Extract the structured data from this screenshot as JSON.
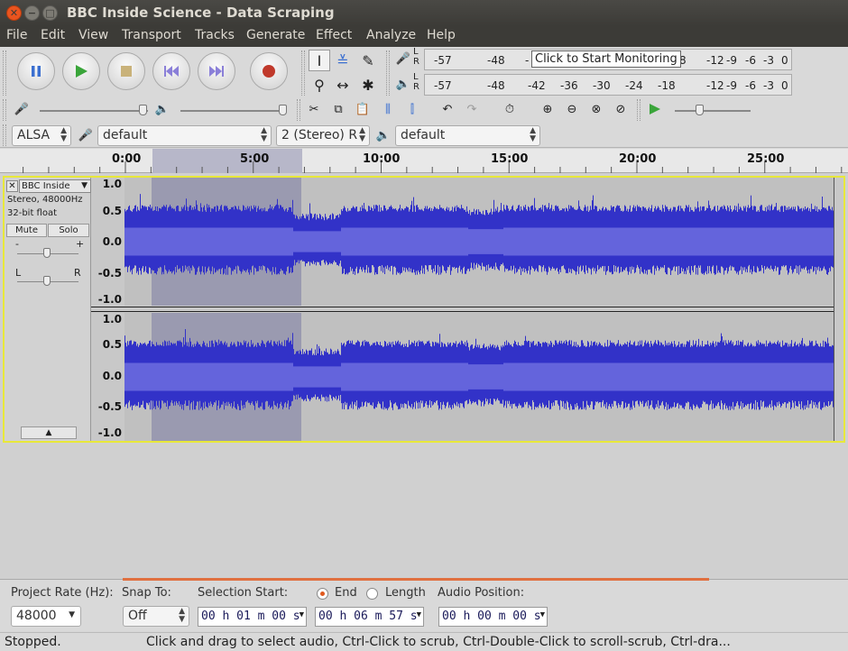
{
  "window": {
    "title": "BBC Inside Science - Data Scraping"
  },
  "menu": [
    "File",
    "Edit",
    "View",
    "Transport",
    "Tracks",
    "Generate",
    "Effect",
    "Analyze",
    "Help"
  ],
  "meters": {
    "record_scale": [
      "-57",
      "-48",
      "-",
      "8",
      "-12",
      "-9",
      "-6",
      "-3",
      "0"
    ],
    "play_scale": [
      "-57",
      "-48",
      "-42",
      "-36",
      "-30",
      "-24",
      "-18",
      "-12",
      "-9",
      "-6",
      "-3",
      "0"
    ],
    "tooltip": "Click to Start Monitoring",
    "lr_top": "L R",
    "lr_bottom": "L R"
  },
  "device": {
    "host": "ALSA",
    "recording_device": "default",
    "channels": "2 (Stereo) R",
    "playback_device": "default"
  },
  "ruler": {
    "labels": [
      "0:00",
      "5:00",
      "10:00",
      "15:00",
      "20:00",
      "25:00"
    ]
  },
  "track": {
    "name": "BBC Inside",
    "format": "Stereo, 48000Hz",
    "bitdepth": "32-bit float",
    "mute": "Mute",
    "solo": "Solo",
    "pan_left": "L",
    "pan_right": "R",
    "gain_minus": "-",
    "gain_plus": "+",
    "scale": [
      "1.0",
      "0.5",
      "0.0",
      "-0.5",
      "-1.0"
    ]
  },
  "selection_bar": {
    "project_rate_label": "Project Rate (Hz):",
    "project_rate": "48000",
    "snap_label": "Snap To:",
    "snap_value": "Off",
    "selection_start_label": "Selection Start:",
    "end_label": "End",
    "length_label": "Length",
    "audio_position_label": "Audio Position:",
    "selection_start": "00 h 01 m 00 s",
    "selection_end": "00 h 06 m 57 s",
    "audio_position": "00 h 00 m 00 s"
  },
  "status": {
    "state": "Stopped.",
    "hint": "Click and drag to select audio, Ctrl-Click to scrub, Ctrl-Double-Click to scroll-scrub, Ctrl-dra..."
  },
  "colors": {
    "waveform": "#3232c8",
    "waveform_rms": "#6464dc",
    "selection": "#9a9ab0",
    "track_border": "#e8e83a",
    "accent": "#e05a1f"
  }
}
